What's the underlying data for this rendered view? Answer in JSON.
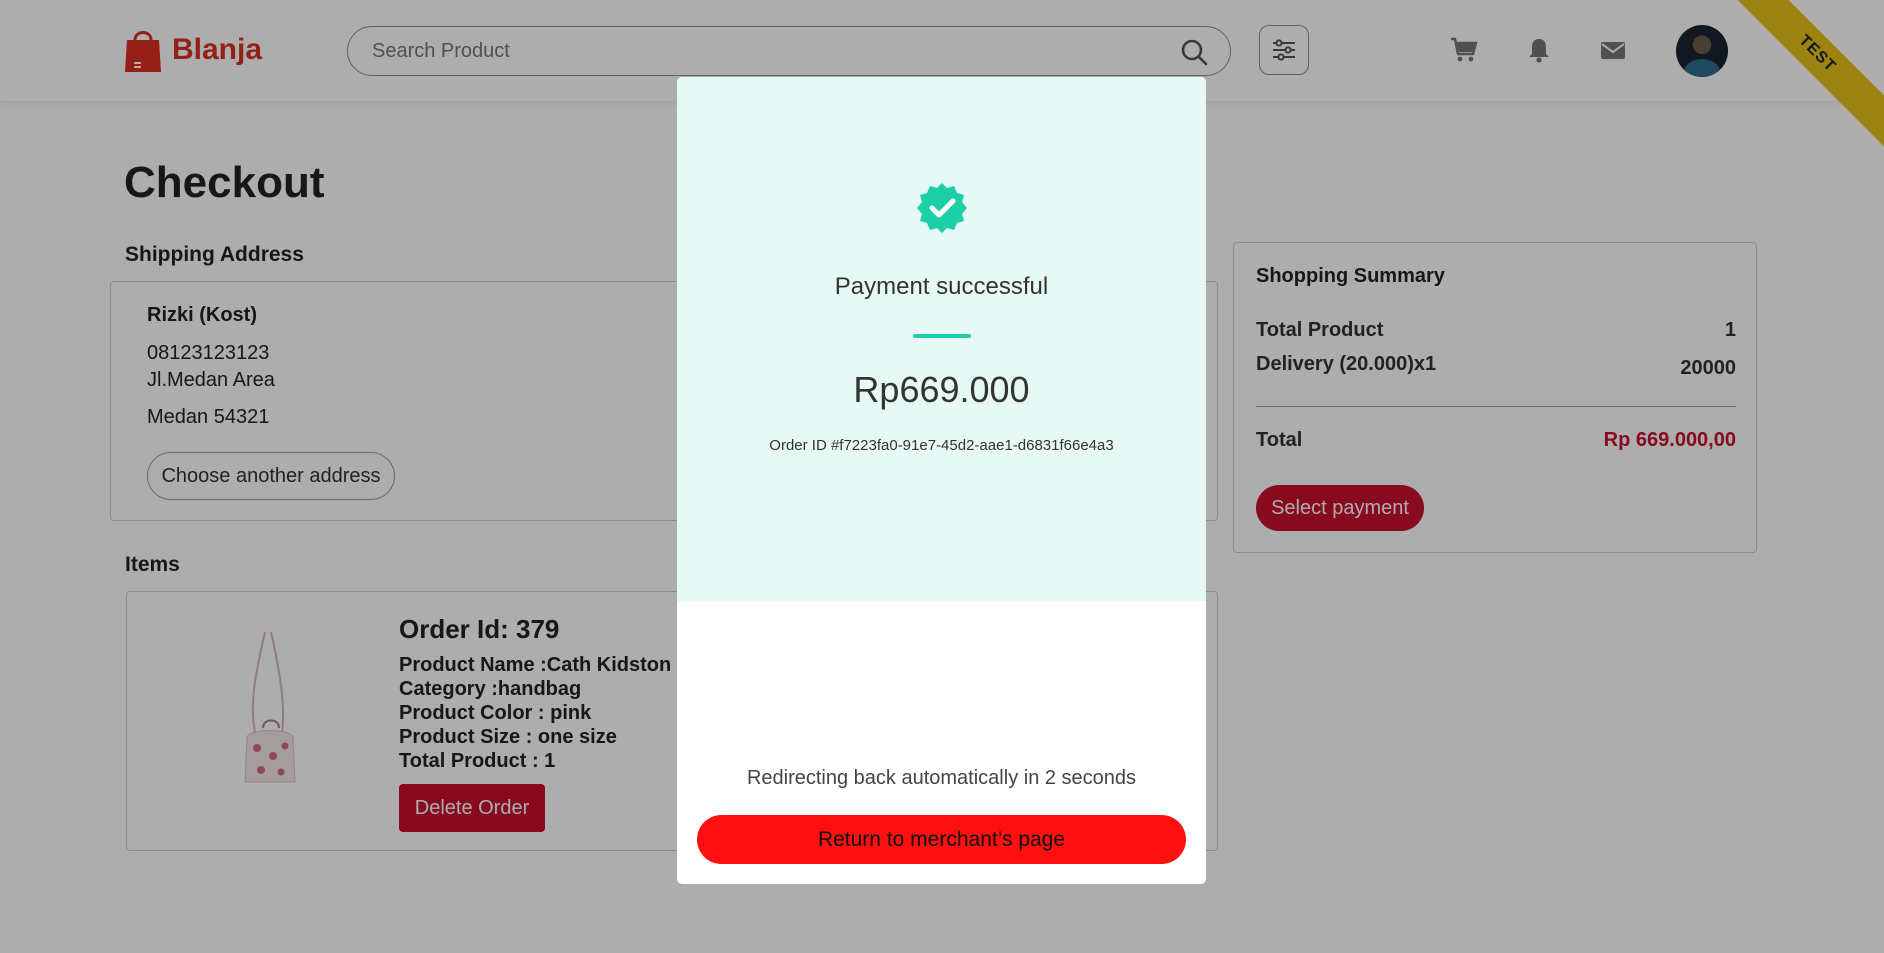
{
  "header": {
    "brand": "Blanja",
    "search_placeholder": "Search Product",
    "icons": [
      "search-icon",
      "filter-icon",
      "cart-icon",
      "bell-icon",
      "mail-icon"
    ],
    "ribbon": "TEST"
  },
  "page": {
    "title": "Checkout",
    "shipping_label": "Shipping Address",
    "items_label": "Items"
  },
  "address": {
    "name": "Rizki (Kost)",
    "phone": "08123123123",
    "street": "Jl.Medan Area",
    "city": "Medan 54321",
    "choose_button": "Choose another address"
  },
  "item": {
    "order_id": "Order Id: 379",
    "product_name": "Product Name :Cath Kidston",
    "category": "Category :handbag",
    "color": "Product Color : pink",
    "size": "Product Size : one size",
    "total": "Total Product : 1",
    "delete_button": "Delete Order"
  },
  "summary": {
    "title": "Shopping Summary",
    "total_product_label": "Total Product",
    "total_product_value": "1",
    "delivery_label": "Delivery (20.000)x1",
    "delivery_value": "20000",
    "total_label": "Total",
    "total_value": "Rp 669.000,00",
    "select_payment": "Select payment"
  },
  "modal": {
    "status": "Payment successful",
    "amount": "Rp669.000",
    "order_id": "Order ID #f7223fa0-91e7-45d2-aae1-d6831f66e4a3",
    "redirect_text": "Redirecting back automatically in 2 seconds",
    "return_button": "Return to merchant’s page"
  },
  "colors": {
    "brand_red": "#db3022",
    "accent_red": "#c8102e",
    "success_teal": "#1ccfa9",
    "modal_top_bg": "#e6f9f5",
    "return_red": "#ff0f0f",
    "ribbon_yellow": "#e7c21a"
  }
}
